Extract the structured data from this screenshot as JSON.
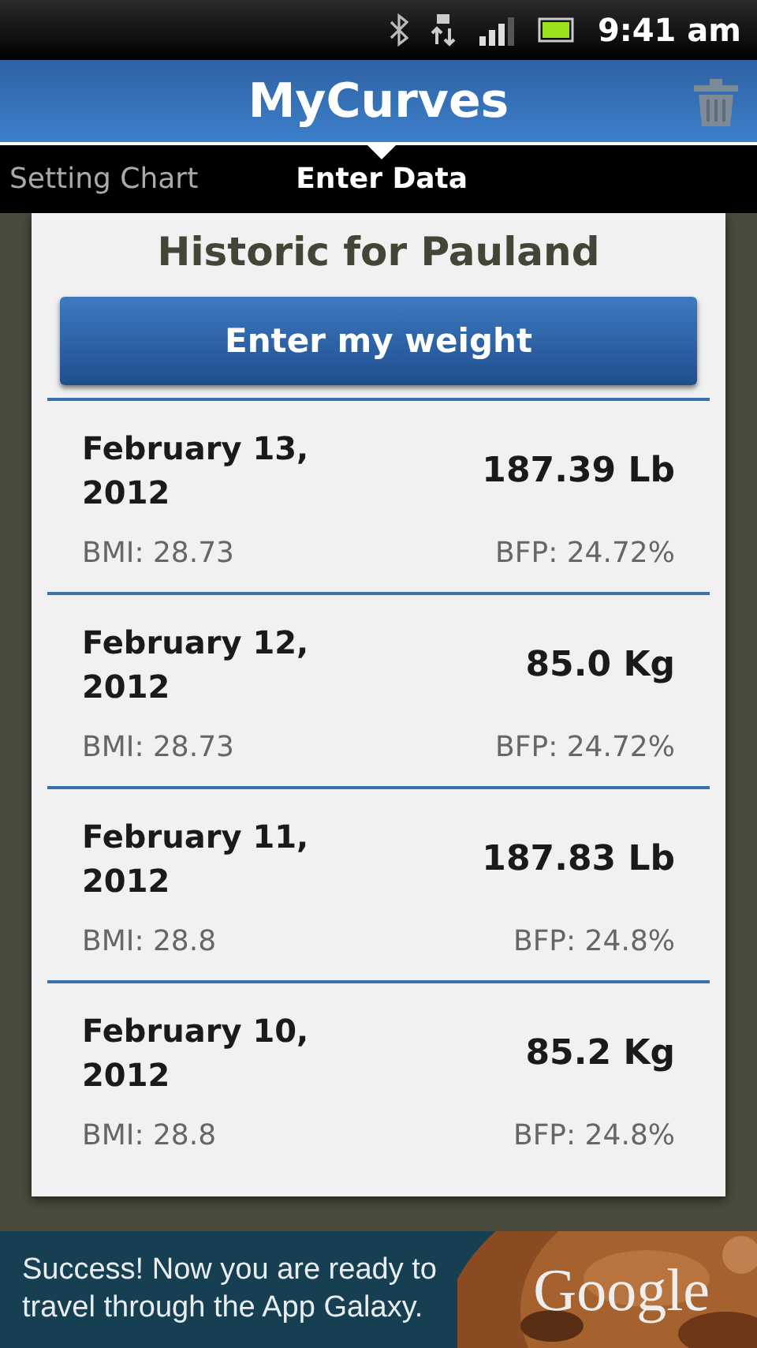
{
  "status_bar": {
    "time": "9:41 am"
  },
  "app_bar": {
    "title": "MyCurves"
  },
  "tabs": [
    {
      "label": "Setting Chart",
      "selected": false
    },
    {
      "label": "Enter Data",
      "selected": true
    }
  ],
  "card": {
    "title": "Historic for Pauland",
    "button": "Enter my weight",
    "entries": [
      {
        "date": "February 13, 2012",
        "weight": "187.39 Lb",
        "bmi": "BMI: 28.73",
        "bfp": "BFP: 24.72%"
      },
      {
        "date": "February 12, 2012",
        "weight": "85.0 Kg",
        "bmi": "BMI: 28.73",
        "bfp": "BFP: 24.72%"
      },
      {
        "date": "February 11, 2012",
        "weight": "187.83 Lb",
        "bmi": "BMI: 28.8",
        "bfp": "BFP: 24.8%"
      },
      {
        "date": "February 10, 2012",
        "weight": "85.2 Kg",
        "bmi": "BMI: 28.8",
        "bfp": "BFP: 24.8%"
      }
    ]
  },
  "ad": {
    "text": "Success! Now you are ready to travel through the App Galaxy.",
    "brand": "Google"
  }
}
